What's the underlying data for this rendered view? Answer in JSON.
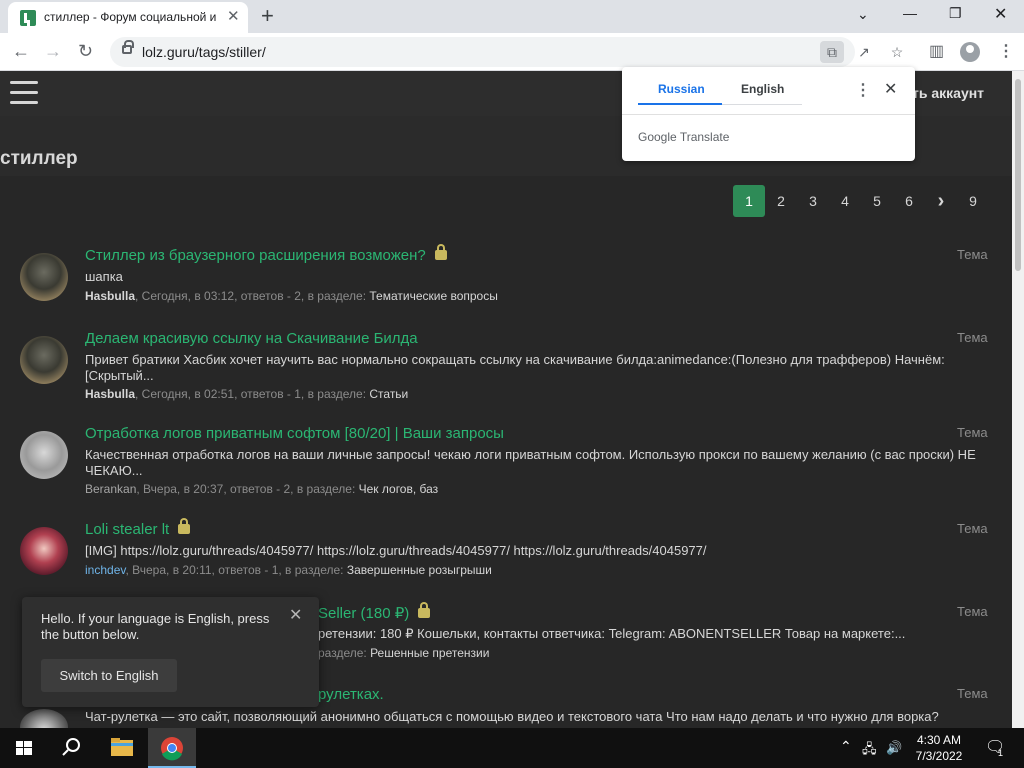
{
  "browser": {
    "tab_title": "стиллер - Форум социальной и",
    "url": "lolz.guru/tags/stiller/",
    "colors": {
      "tabstrip": "#dee1e6",
      "toolbar": "#ffffff"
    }
  },
  "site": {
    "header_account": "ть аккаунт",
    "page_title": "стиллер",
    "pagination": [
      "1",
      "2",
      "3",
      "4",
      "5",
      "6",
      "›",
      "9"
    ],
    "colors": {
      "accent": "#2e8b57",
      "title_green": "#2bb673",
      "bg": "#272727"
    },
    "threads": [
      {
        "title": "Стиллер из браузерного расширения возможен?",
        "locked": true,
        "snippet": "шапка",
        "user": "Hasbulla",
        "meta": ", Сегодня, в 03:12, ответов - 2, в разделе: ",
        "forum": "Тематические вопросы",
        "type": "Тема"
      },
      {
        "title": "Делаем красивую ссылку на Скачивание Билда",
        "locked": false,
        "snippet": "Привет братики Хасбик хочет научить вас нормально сокращать ссылку на скачивание билда:animedance:(Полезно для трафферов) Начнём: [Скрытый...",
        "user": "Hasbulla",
        "meta": ", Сегодня, в 02:51, ответов - 1, в разделе: ",
        "forum": "Статьи",
        "type": "Тема"
      },
      {
        "title": "Отработка логов приватным софтом [80/20] | Ваши запросы",
        "locked": false,
        "snippet": "Качественная отработка логов на ваши личные запросы! чекаю логи приватным софтом. Использую прокси по вашему желанию (с вас проски) НЕ ЧЕКАЮ...",
        "user": "Berankan",
        "meta": ", Вчера, в 20:37, ответов - 2, в разделе: ",
        "forum": "Чек логов, баз",
        "type": "Тема"
      },
      {
        "title": "Loli stealer lt",
        "locked": true,
        "snippet": "[IMG] https://lolz.guru/threads/4045977/ https://lolz.guru/threads/4045977/ https://lolz.guru/threads/4045977/",
        "user": "inchdev",
        "meta": ", Вчера, в 20:11, ответов - 1, в разделе: ",
        "forum": "Завершенные розыгрыши",
        "type": "Тема"
      },
      {
        "title": "Seller (180 ₽)",
        "locked": true,
        "snippet": "ретензии: 180 ₽ Кошельки, контакты ответчика: Telegram: ABONENTSELLER Товар на маркете:...",
        "user": "",
        "meta": "разделе: ",
        "forum": "Решенные претензии",
        "type": "Тема"
      },
      {
        "title": "рулетках.",
        "locked": false,
        "snippet": "Чат-рулетка — это сайт, позволяющий анонимно общаться с помощью видео и текстового чата Что нам надо делать и что нужно для ворка?",
        "user": "",
        "meta": "",
        "forum": "",
        "type": "Тема"
      }
    ]
  },
  "translate_popup": {
    "tab_source": "Russian",
    "tab_target": "English",
    "brand": "Google Translate"
  },
  "language_notice": {
    "text": "Hello. If your language is English, press the button below.",
    "button": "Switch to English"
  },
  "taskbar": {
    "time": "4:30 AM",
    "date": "7/3/2022",
    "notification_count": "1"
  }
}
